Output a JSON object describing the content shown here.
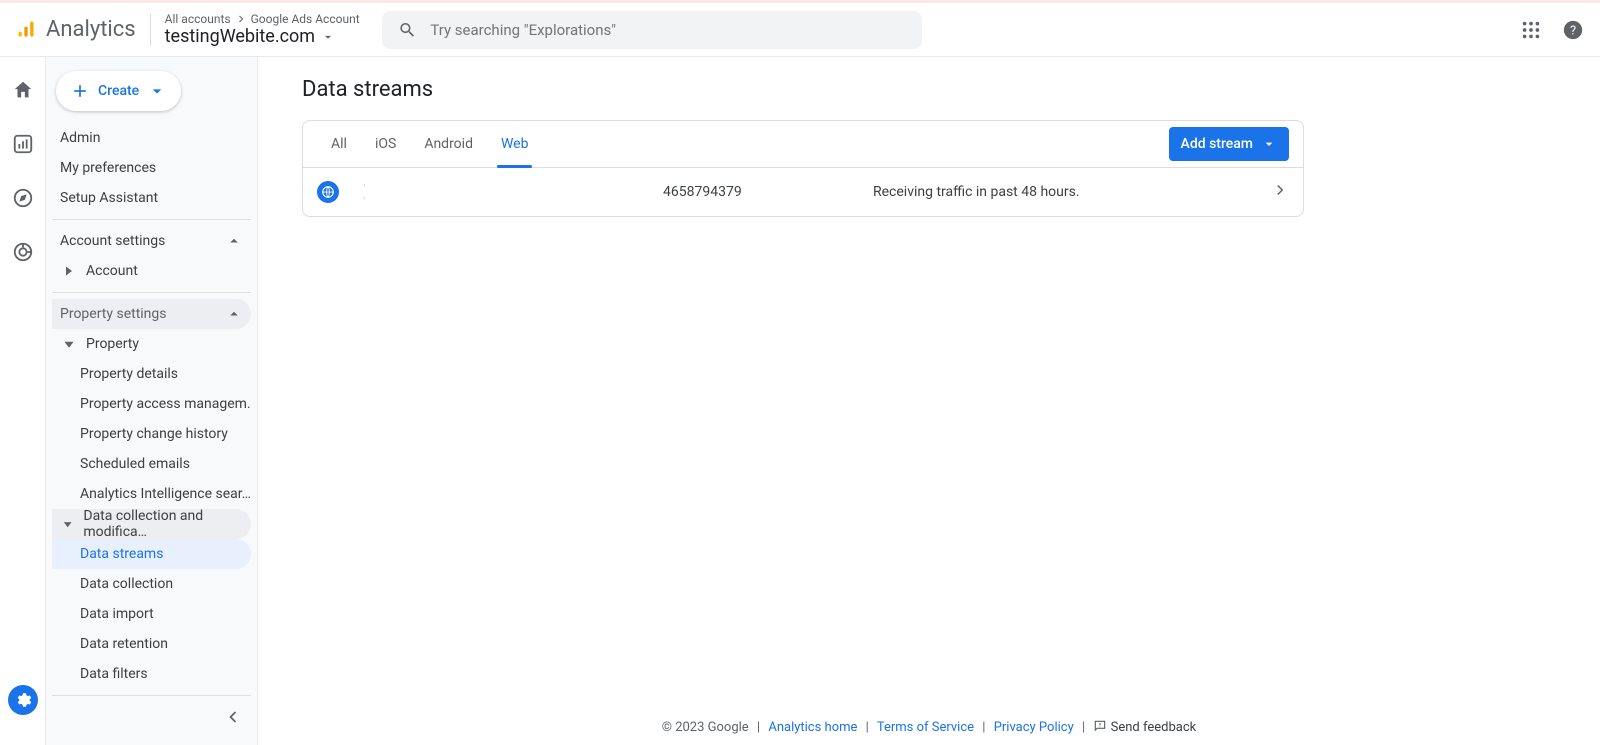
{
  "header": {
    "product": "Analytics",
    "breadcrumb_all": "All accounts",
    "breadcrumb_account": "Google Ads Account",
    "property": "testingWebite.com",
    "search_placeholder": "Try searching \"Explorations\""
  },
  "sidebar": {
    "create": "Create",
    "admin": "Admin",
    "my_prefs": "My preferences",
    "setup": "Setup Assistant",
    "account_settings": "Account settings",
    "account": "Account",
    "property_settings": "Property settings",
    "property": "Property",
    "property_items": {
      "details": "Property details",
      "access": "Property access managem…",
      "change": "Property change history",
      "emails": "Scheduled emails",
      "intel": "Analytics Intelligence sear…"
    },
    "data_mod": "Data collection and modifica…",
    "data_items": {
      "streams": "Data streams",
      "collection": "Data collection",
      "import": "Data import",
      "retention": "Data retention",
      "filters": "Data filters"
    }
  },
  "page": {
    "title": "Data streams",
    "tabs": {
      "all": "All",
      "ios": "iOS",
      "android": "Android",
      "web": "Web"
    },
    "add_stream": "Add stream",
    "row": {
      "id": "4658794379",
      "status": "Receiving traffic in past 48 hours."
    }
  },
  "footer": {
    "copyright": "© 2023 Google",
    "home": "Analytics home",
    "tos": "Terms of Service",
    "privacy": "Privacy Policy",
    "feedback": "Send feedback"
  }
}
